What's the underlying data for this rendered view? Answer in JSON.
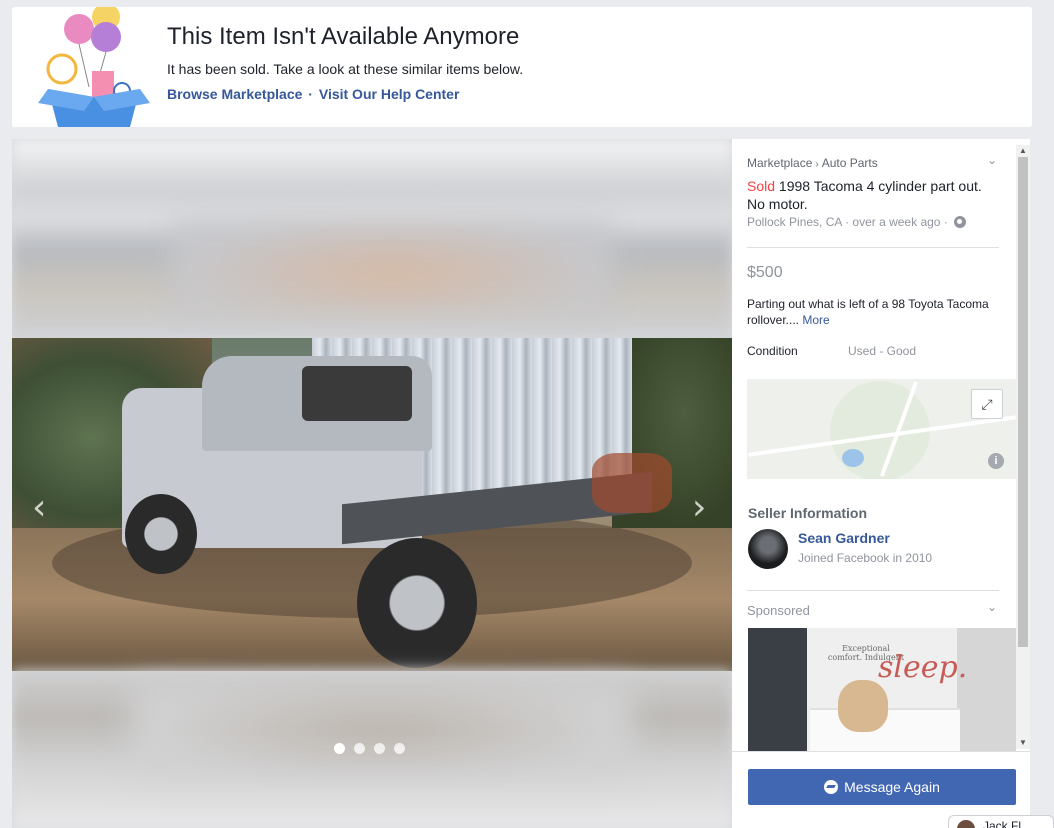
{
  "banner": {
    "title": "This Item Isn't Available Anymore",
    "subtitle": "It has been sold. Take a look at these similar items below.",
    "link_browse": "Browse Marketplace",
    "link_separator": "·",
    "link_help": "Visit Our Help Center"
  },
  "photos": {
    "count": 4,
    "active_index": 0,
    "prev_icon": "chevron-left-icon",
    "next_icon": "chevron-right-icon",
    "prev_glyph": "‹",
    "next_glyph": "›"
  },
  "listing": {
    "breadcrumb_root": "Marketplace",
    "breadcrumb_separator": "›",
    "breadcrumb_category": "Auto Parts",
    "status": "Sold",
    "title": "1998 Tacoma 4 cylinder part out. No motor.",
    "location": "Pollock Pines, CA",
    "time": "over a week ago",
    "meta_separator": "·",
    "price": "$500",
    "description": "Parting out what is left of a 98 Toyota Tacoma rollover....",
    "more_label": "More",
    "condition_label": "Condition",
    "condition_value": "Used - Good"
  },
  "seller": {
    "heading": "Seller Information",
    "name": "Sean Gardner",
    "joined": "Joined Facebook in 2010"
  },
  "sponsored": {
    "label": "Sponsored",
    "ad_tagline": "Exceptional comfort. Indulgent",
    "ad_word": "sleep."
  },
  "actions": {
    "message_label": "Message Again"
  },
  "chat": {
    "name": "Jack Fl"
  },
  "colors": {
    "link": "#365899",
    "sold": "#fa3e3e",
    "primary_button": "#4267b2",
    "background": "#e9ebee"
  }
}
